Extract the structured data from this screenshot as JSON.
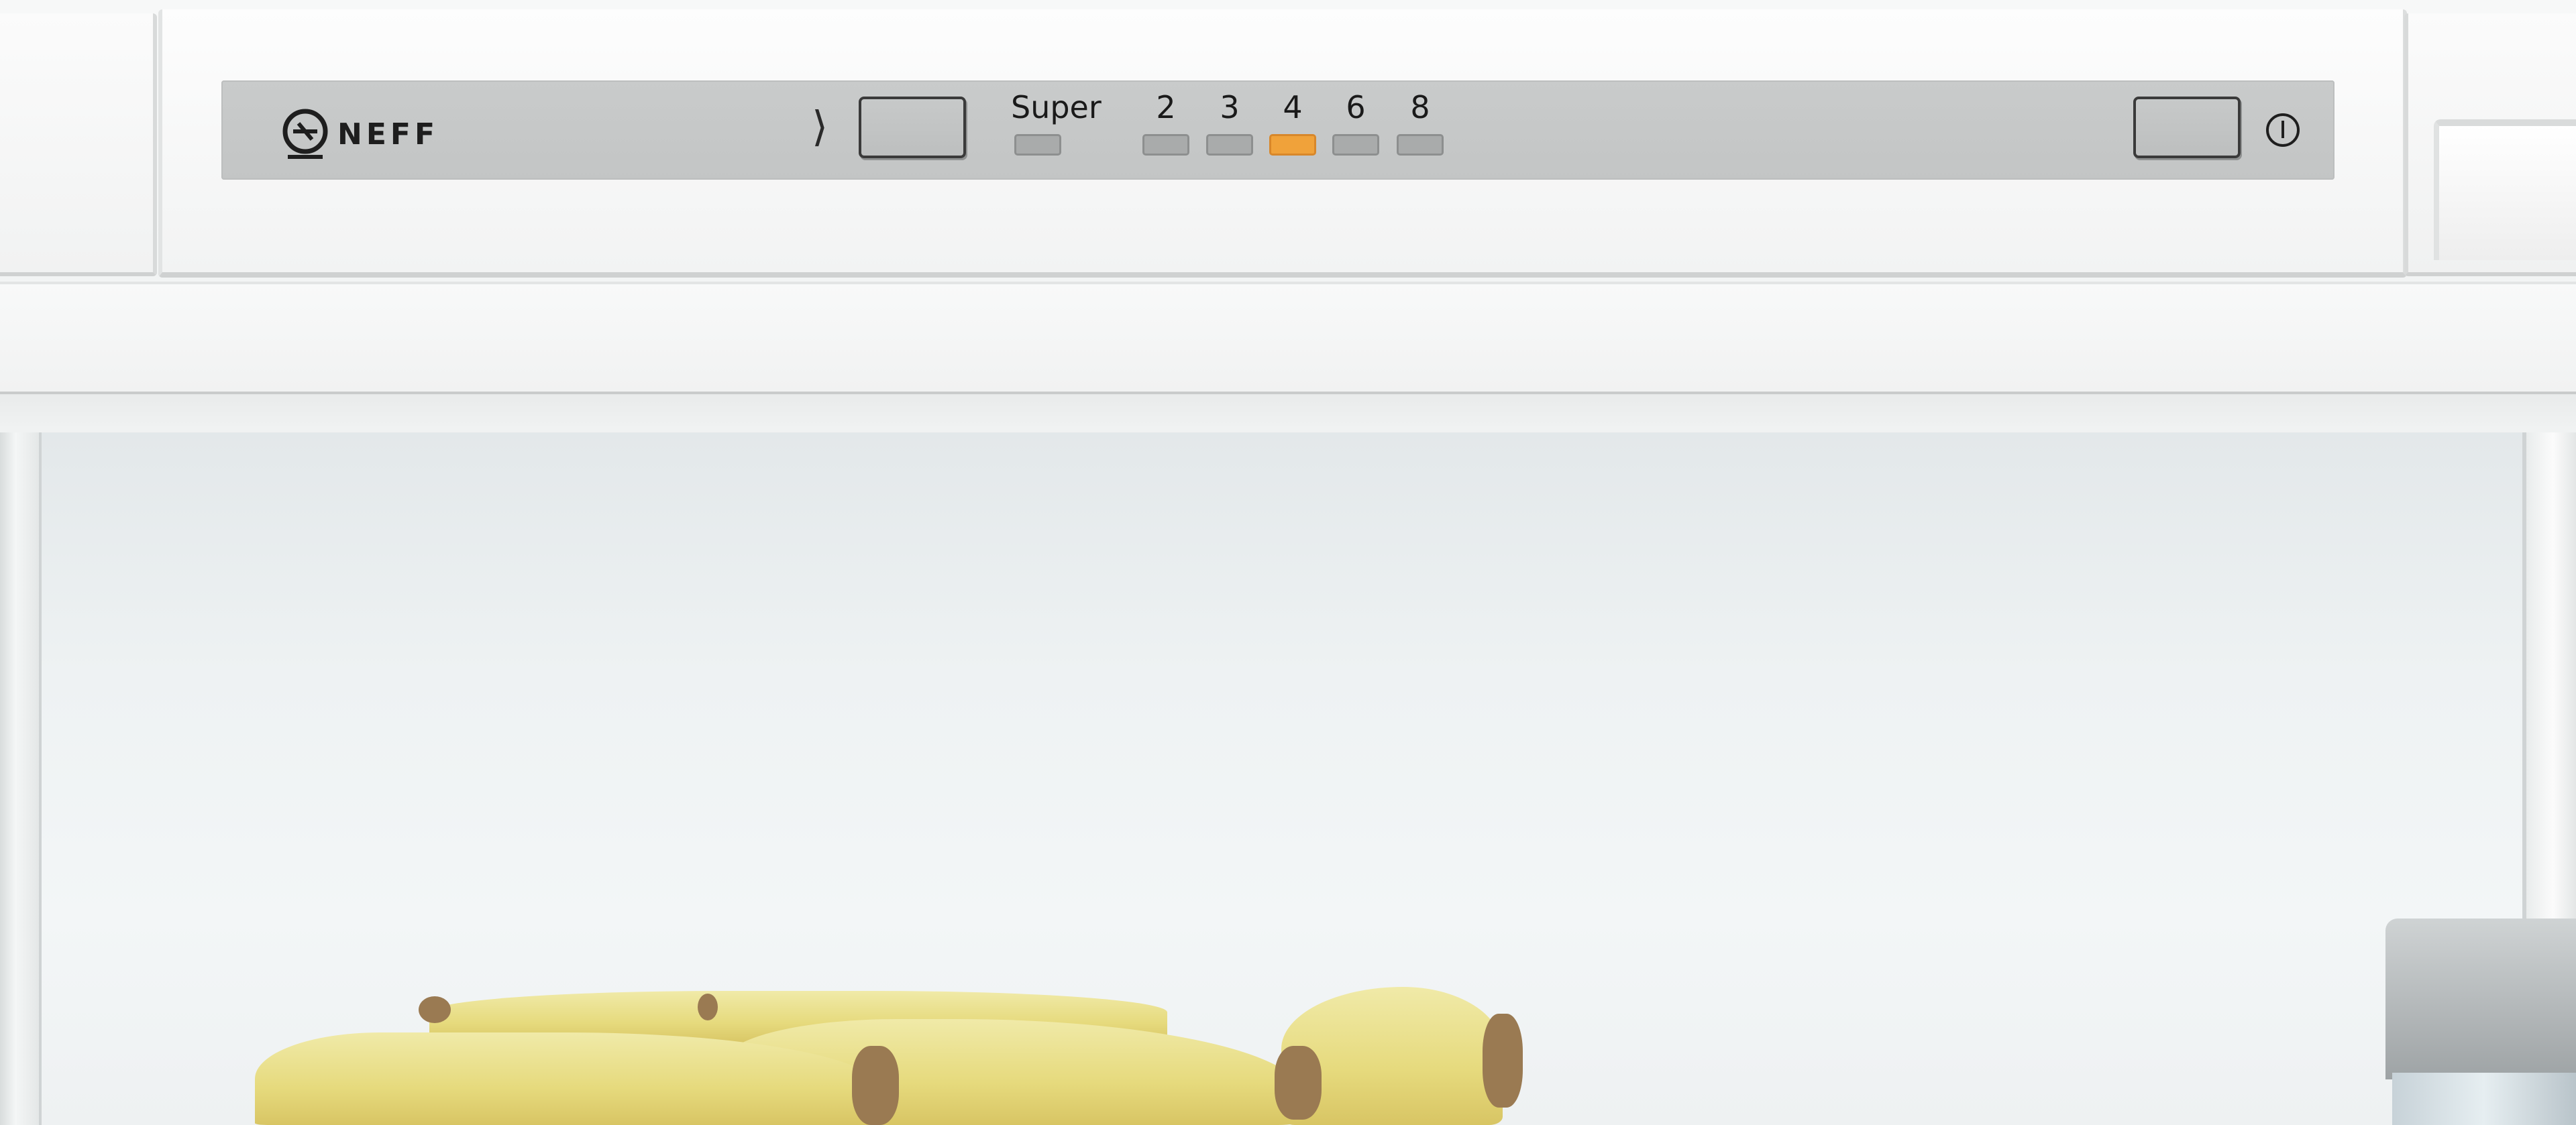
{
  "brand": {
    "name": "NEFF"
  },
  "controls": {
    "levels": [
      {
        "label": "Super",
        "active": false
      },
      {
        "label": "2",
        "active": false
      },
      {
        "label": "3",
        "active": false
      },
      {
        "label": "4",
        "active": true
      },
      {
        "label": "6",
        "active": false
      },
      {
        "label": "8",
        "active": false
      }
    ],
    "select_icon": "chevron-right-icon",
    "power_icon": "power-icon"
  },
  "colors": {
    "panel": "#c6c8c8",
    "led_active": "#f0a23a",
    "led_inactive": "#a9abab",
    "body": "#f4f5f5"
  }
}
